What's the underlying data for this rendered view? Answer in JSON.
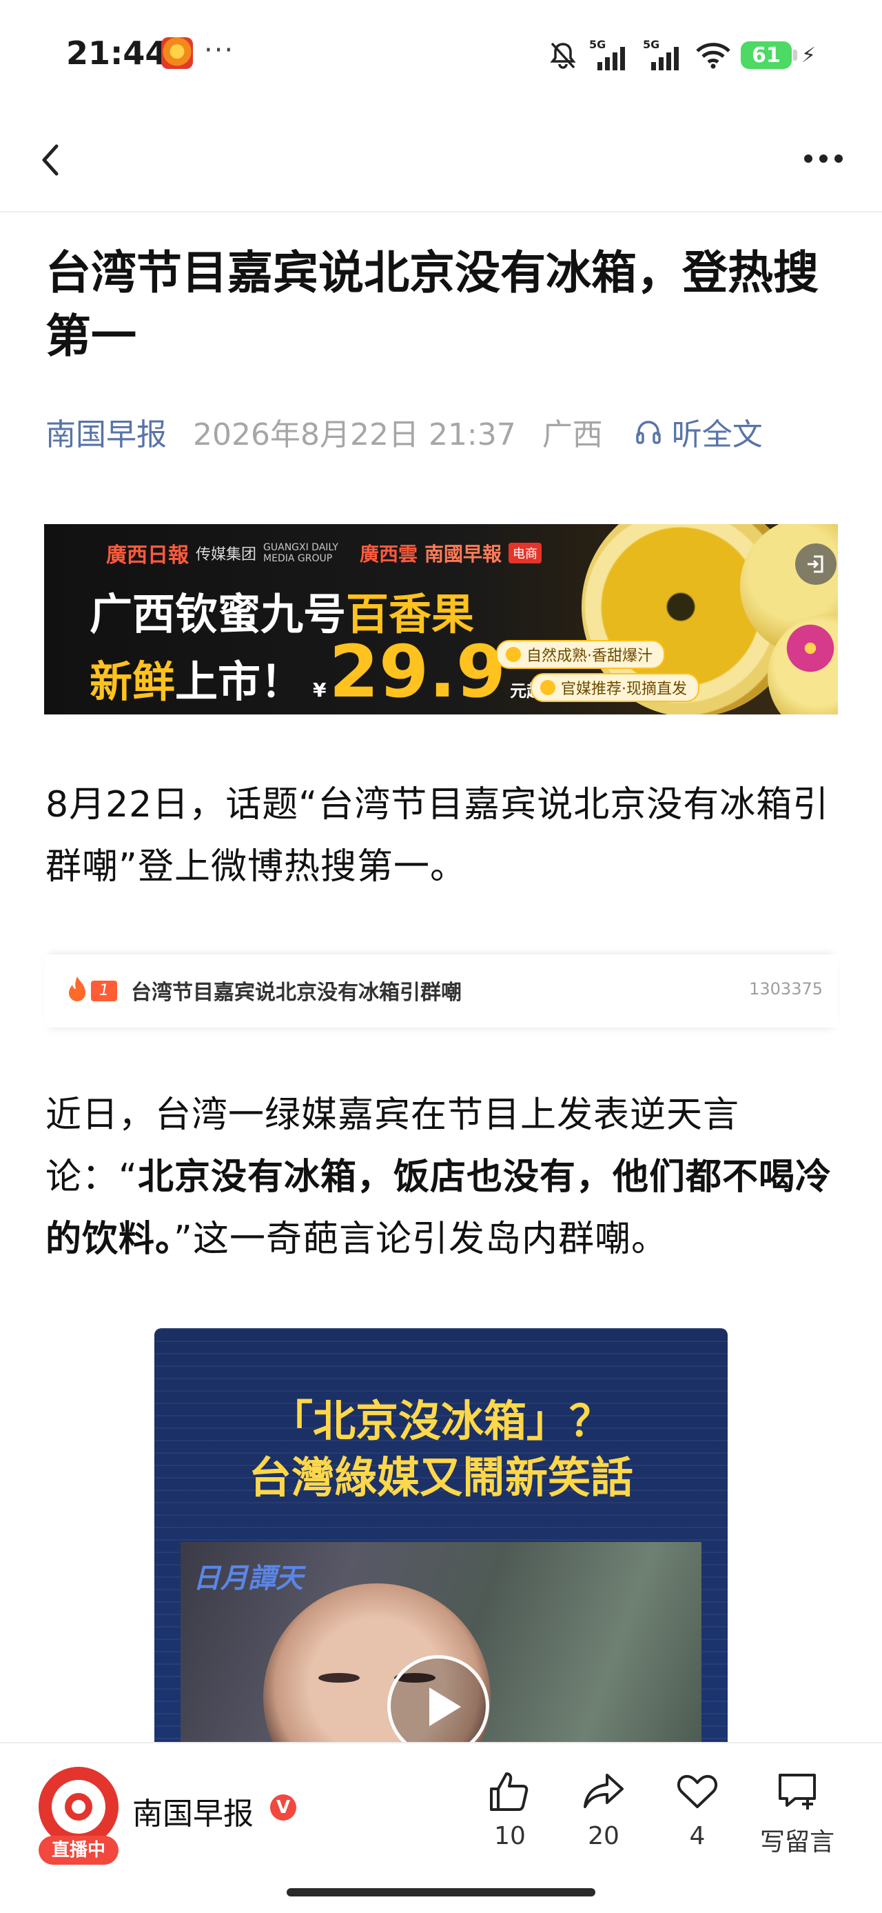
{
  "status_bar": {
    "time": "21:44",
    "more": "···",
    "network1": "5G",
    "network2": "5G",
    "battery": "61",
    "icons": [
      "app-notification-icon",
      "mute-icon",
      "signal-icon",
      "signal-icon",
      "wifi-icon",
      "battery-icon",
      "charging-icon"
    ]
  },
  "nav": {
    "back_icon": "chevron-left-icon",
    "more_icon": "more-dots-icon"
  },
  "article": {
    "title": "台湾节目嘉宾说北京没有冰箱，登热搜第一",
    "source": "南国早报",
    "date": "2026年8月22日 21:37",
    "region": "广西",
    "listen_label": "听全文",
    "paragraph1": "8月22日，话题“台湾节目嘉宾说北京没有冰箱引群嘲”登上微博热搜第一。",
    "paragraph2_prefix": "近日，台湾一绿媒嘉宾在节目上发表逆天言论：“",
    "paragraph2_quote": "北京没有冰箱，饭店也没有，他们都不喝冷的饮料。",
    "paragraph2_suffix": "”这一奇葩言论引发岛内群嘲。"
  },
  "ad": {
    "brand_logo": "廣西日報",
    "brand_group": "传媒集团",
    "brand_en": "GUANGXI DAILY MEDIA GROUP",
    "brand2": "廣西雲",
    "brand3": "南國早報",
    "brand_badge": "电商",
    "line1_white": "广西钦蜜九号",
    "line1_yellow": "百香果",
    "line2_yellow": "新鲜",
    "line2_white": "上市！",
    "currency": "¥",
    "price": "29.9",
    "unit": "元起",
    "tag1": "自然成熟·香甜爆汁",
    "tag2": "官媒推荐·现摘直发",
    "exit_icon": "exit-icon"
  },
  "hot_search": {
    "rank": "1",
    "title": "台湾节目嘉宾说北京没有冰箱引群嘲",
    "count": "1303375"
  },
  "video": {
    "headline1": "「北京沒冰箱」？",
    "headline2": "台灣綠媒又鬧新笑話",
    "program_logo": "日月譚天",
    "play_icon": "play-icon"
  },
  "bottom_bar": {
    "account_name": "南国早报",
    "live_label": "直播中",
    "verified_badge": "V",
    "likes": "10",
    "shares": "20",
    "favorites": "4",
    "comment_label": "写留言"
  },
  "colors": {
    "link_blue": "#5874a8",
    "meta_gray": "#a6a6a6",
    "brand_red": "#e3352d",
    "ad_yellow": "#ffc21e",
    "hot_orange": "#ff5d35"
  }
}
